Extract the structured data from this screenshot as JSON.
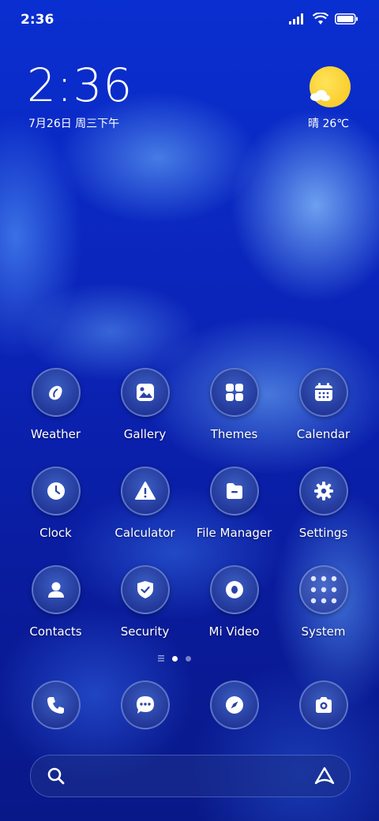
{
  "status_bar": {
    "time": "2:36"
  },
  "clock_widget": {
    "time": "2:36",
    "date": "7月26日 周三下午"
  },
  "weather_widget": {
    "text": "晴 26℃",
    "icon": "sun-cloud-icon"
  },
  "apps": [
    {
      "label": "Weather",
      "icon": "weather-drop-icon"
    },
    {
      "label": "Gallery",
      "icon": "gallery-icon"
    },
    {
      "label": "Themes",
      "icon": "themes-grid-icon"
    },
    {
      "label": "Calendar",
      "icon": "calendar-icon"
    },
    {
      "label": "Clock",
      "icon": "clock-icon"
    },
    {
      "label": "Calculator",
      "icon": "calculator-icon"
    },
    {
      "label": "File Manager",
      "icon": "folder-icon"
    },
    {
      "label": "Settings",
      "icon": "gear-icon"
    },
    {
      "label": "Contacts",
      "icon": "contacts-icon"
    },
    {
      "label": "Security",
      "icon": "shield-icon"
    },
    {
      "label": "Mi Video",
      "icon": "video-icon"
    },
    {
      "label": "System",
      "icon": "folder-group-icon"
    }
  ],
  "dock": [
    {
      "icon": "phone-icon"
    },
    {
      "icon": "message-icon"
    },
    {
      "icon": "compass-icon"
    },
    {
      "icon": "camera-icon"
    }
  ],
  "page_indicator": {
    "pages": 2,
    "current": 1
  },
  "search_bar": {
    "left_icon": "search-icon",
    "right_icon": "assistant-icon"
  },
  "colors": {
    "accent": "#2a43a8",
    "sun": "#f7c51b"
  }
}
